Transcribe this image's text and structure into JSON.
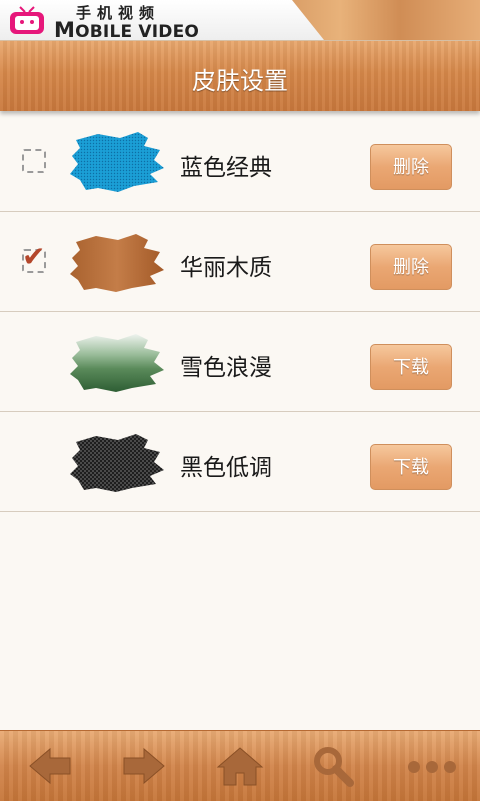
{
  "header": {
    "logo_cn": "手机视频",
    "logo_en_first": "M",
    "logo_en_rest": "OBILE VIDEO"
  },
  "titlebar": {
    "title": "皮肤设置"
  },
  "skins": [
    {
      "name": "蓝色经典",
      "checkbox": "unchecked",
      "action": "删除",
      "swatch": "blue"
    },
    {
      "name": "华丽木质",
      "checkbox": "checked",
      "action": "删除",
      "swatch": "wood"
    },
    {
      "name": "雪色浪漫",
      "checkbox": "none",
      "action": "下载",
      "swatch": "green"
    },
    {
      "name": "黑色低调",
      "checkbox": "none",
      "action": "下载",
      "swatch": "black"
    }
  ],
  "toolbar": {
    "icons": [
      "back-arrow-icon",
      "forward-arrow-icon",
      "home-icon",
      "search-icon",
      "more-icon"
    ]
  },
  "colors": {
    "wood": "#d6884a",
    "button": "#eaa773",
    "check": "#b4472b",
    "blue_skin": "#1b9fd6",
    "wood_skin": "#b9713f",
    "green_skin": "#4f7f4f",
    "black_skin": "#2a2a2a"
  }
}
